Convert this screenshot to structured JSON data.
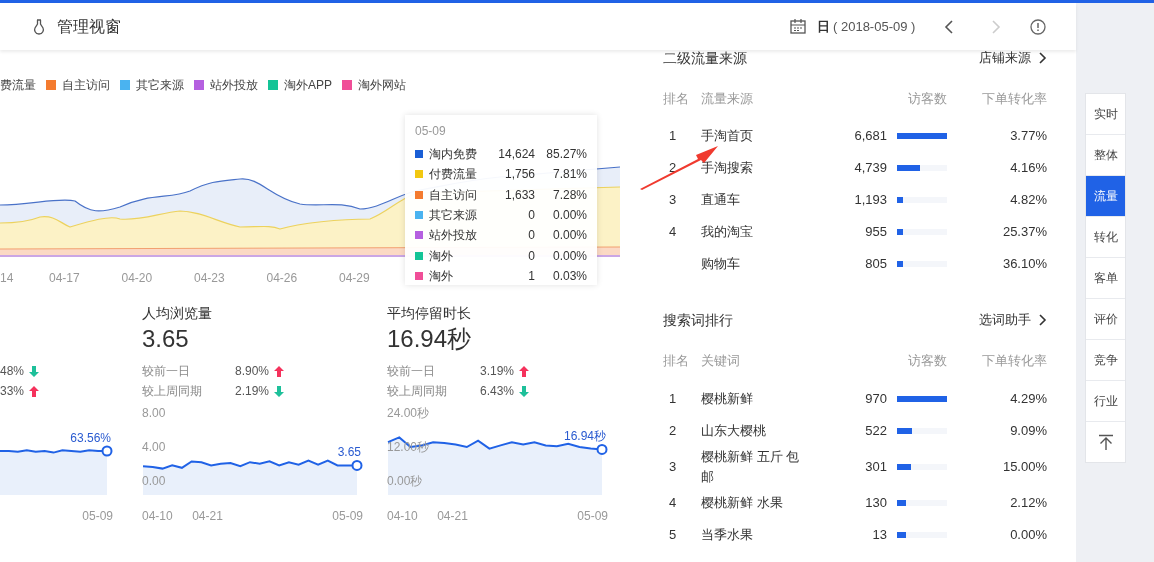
{
  "header": {
    "title": "管理视窗",
    "period": "日",
    "date": "( 2018-05-09 )",
    "nav": [
      {
        "kind": "prev",
        "disabled": false
      },
      {
        "kind": "next",
        "disabled": true
      }
    ]
  },
  "legend": [
    {
      "label": "费流量"
    },
    {
      "label": "自主访问",
      "color": "#f47b2f"
    },
    {
      "label": "其它来源",
      "color": "#4ab3f0"
    },
    {
      "label": "站外投放",
      "color": "#b560e0"
    },
    {
      "label": "淘外APP",
      "color": "#14c497"
    },
    {
      "label": "淘外网站",
      "color": "#f04e98"
    }
  ],
  "trend_chart": {
    "x_labels": [
      "14",
      "04-17",
      "04-20",
      "04-23",
      "04-26",
      "04-29"
    ]
  },
  "tooltip": {
    "date": "05-09",
    "rows": [
      {
        "name": "淘内免费",
        "value": "14,624",
        "share": "85.27%",
        "color": "#1a5fd6"
      },
      {
        "name": "付费流量",
        "value": "1,756",
        "share": "7.81%",
        "color": "#f2c811"
      },
      {
        "name": "自主访问",
        "value": "1,633",
        "share": "7.28%",
        "color": "#f47b2f"
      },
      {
        "name": "其它来源",
        "value": "0",
        "share": "0.00%",
        "color": "#4ab3f0"
      },
      {
        "name": "站外投放",
        "value": "0",
        "share": "0.00%",
        "color": "#b560e0"
      },
      {
        "name": "淘外",
        "value": "0",
        "share": "0.00%",
        "color": "#14c497"
      },
      {
        "name": "淘外",
        "value": "1",
        "share": "0.03%",
        "color": "#f04e98"
      }
    ]
  },
  "metrics": [
    {
      "compare": [
        {
          "value": "48%",
          "kind": "down"
        },
        {
          "value": "33%",
          "kind": "up"
        }
      ],
      "chart": {
        "end_label": "63.56%",
        "x_labels": [
          "05-09"
        ]
      }
    },
    {
      "title": "人均浏览量",
      "value": "3.65",
      "compare": [
        {
          "label": "较前一日",
          "value": "8.90%",
          "kind": "up"
        },
        {
          "label": "较上周同期",
          "value": "2.19%",
          "kind": "down"
        }
      ],
      "chart": {
        "y_labels": [
          "8.00",
          "4.00",
          "0.00"
        ],
        "end_label": "3.65",
        "x_labels": [
          "04-10",
          "04-21",
          "05-09"
        ]
      }
    },
    {
      "title": "平均停留时长",
      "value": "16.94秒",
      "compare": [
        {
          "label": "较前一日",
          "value": "3.19%",
          "kind": "up"
        },
        {
          "label": "较上周同期",
          "value": "6.43%",
          "kind": "down"
        }
      ],
      "chart": {
        "y_labels": [
          "24.00秒",
          "12.00秒",
          "0.00秒"
        ],
        "end_label": "16.94秒",
        "x_labels": [
          "04-10",
          "04-21",
          "05-09"
        ]
      }
    }
  ],
  "source_table": {
    "title": "二级流量来源",
    "link": "店铺来源",
    "columns": [
      "排名",
      "流量来源",
      "访客数",
      "下单转化率"
    ],
    "rows": [
      {
        "rank": "1",
        "name": "手淘首页",
        "visitors": "6,681",
        "level": 1,
        "rate": "3.77%"
      },
      {
        "rank": "2",
        "name": "手淘搜索",
        "visitors": "4,739",
        "level": 0.46,
        "rate": "4.16%"
      },
      {
        "rank": "3",
        "name": "直通车",
        "visitors": "1,193",
        "level": 0.12,
        "rate": "4.82%"
      },
      {
        "rank": "4",
        "name": "我的淘宝",
        "visitors": "955",
        "level": 0.12,
        "rate": "25.37%"
      },
      {
        "name": "购物车",
        "visitors": "805",
        "level": 0.12,
        "rate": "36.10%"
      }
    ]
  },
  "keyword_table": {
    "title": "搜索词排行",
    "link": "选词助手",
    "columns": [
      "排名",
      "关键词",
      "访客数",
      "下单转化率"
    ],
    "rows": [
      {
        "rank": "1",
        "name": "樱桃新鲜",
        "visitors": "970",
        "level": 1,
        "rate": "4.29%"
      },
      {
        "rank": "2",
        "name": "山东大樱桃",
        "visitors": "522",
        "level": 0.3,
        "rate": "9.09%"
      },
      {
        "rank": "3",
        "name": "樱桃新鲜 五斤 包邮",
        "visitors": "301",
        "level": 0.28,
        "rate": "15.00%"
      },
      {
        "rank": "4",
        "name": "樱桃新鲜 水果",
        "visitors": "130",
        "level": 0.18,
        "rate": "2.12%"
      },
      {
        "rank": "5",
        "name": "当季水果",
        "visitors": "13",
        "level": 0.18,
        "rate": "0.00%"
      }
    ]
  },
  "side_nav": [
    {
      "label": "实时",
      "selected": false
    },
    {
      "label": "整体",
      "selected": false
    },
    {
      "label": "流量",
      "selected": true
    },
    {
      "label": "转化",
      "selected": false
    },
    {
      "label": "客单",
      "selected": false
    },
    {
      "label": "评价",
      "selected": false
    },
    {
      "label": "竞争",
      "selected": false
    },
    {
      "label": "行业",
      "selected": false
    }
  ]
}
